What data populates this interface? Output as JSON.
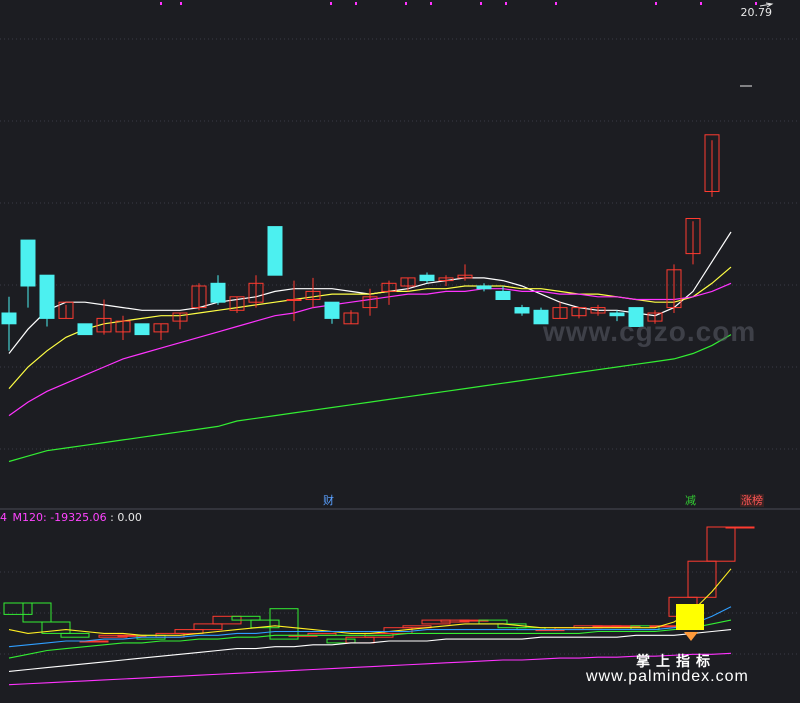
{
  "main_chart": {
    "price_label": "20.79",
    "event_badges": [
      {
        "text": "财",
        "color": "#5aa0ff"
      },
      {
        "text": "减",
        "color": "#33cc33"
      },
      {
        "text": "涨榜",
        "color": "#ff5555"
      }
    ]
  },
  "indicator": {
    "prefix": "4",
    "name": "M120:",
    "value": "-19325.06",
    "separator": ":",
    "value2": "0.00",
    "colors": {
      "name": "#ff44ff",
      "value2": "#e8e8e8"
    }
  },
  "watermark": {
    "site": "www.palmindex.com",
    "cn": "掌上指标",
    "mid": "www.cgzo.com"
  },
  "colors": {
    "background": "#1c1d22",
    "up": "#ff3b30",
    "down": "#4cf0f0",
    "ma_white": "#ffffff",
    "ma_yellow": "#ffff44",
    "ma_magenta": "#ff33ff",
    "ma_green": "#33ee33",
    "grid": "#3a3c46"
  },
  "chart_data": {
    "type": "candlestick",
    "candles": [
      {
        "o": 2.0,
        "h": 2.6,
        "l": 0.6,
        "c": 1.6
      },
      {
        "o": 4.7,
        "h": 4.7,
        "l": 2.2,
        "c": 3.0
      },
      {
        "o": 3.4,
        "h": 3.4,
        "l": 1.5,
        "c": 1.8
      },
      {
        "o": 1.8,
        "h": 2.3,
        "l": 1.8,
        "c": 2.4
      },
      {
        "o": 1.6,
        "h": 1.6,
        "l": 1.2,
        "c": 1.2
      },
      {
        "o": 1.3,
        "h": 2.5,
        "l": 1.2,
        "c": 1.8
      },
      {
        "o": 1.3,
        "h": 1.9,
        "l": 1.0,
        "c": 1.7
      },
      {
        "o": 1.6,
        "h": 1.6,
        "l": 1.3,
        "c": 1.2
      },
      {
        "o": 1.3,
        "h": 1.6,
        "l": 1.0,
        "c": 1.6
      },
      {
        "o": 1.7,
        "h": 2.0,
        "l": 1.4,
        "c": 2.0
      },
      {
        "o": 2.2,
        "h": 3.1,
        "l": 2.1,
        "c": 3.0
      },
      {
        "o": 3.1,
        "h": 3.4,
        "l": 2.3,
        "c": 2.4
      },
      {
        "o": 2.1,
        "h": 2.6,
        "l": 2.0,
        "c": 2.6
      },
      {
        "o": 2.4,
        "h": 3.4,
        "l": 2.2,
        "c": 3.1
      },
      {
        "o": 5.2,
        "h": 5.2,
        "l": 3.4,
        "c": 3.4
      },
      {
        "o": 2.5,
        "h": 3.2,
        "l": 1.7,
        "c": 2.5
      },
      {
        "o": 2.5,
        "h": 3.3,
        "l": 2.2,
        "c": 2.8
      },
      {
        "o": 2.4,
        "h": 2.4,
        "l": 1.6,
        "c": 1.8
      },
      {
        "o": 1.6,
        "h": 2.1,
        "l": 1.6,
        "c": 2.0
      },
      {
        "o": 2.2,
        "h": 2.9,
        "l": 1.9,
        "c": 2.6
      },
      {
        "o": 2.8,
        "h": 3.2,
        "l": 2.3,
        "c": 3.1
      },
      {
        "o": 3.0,
        "h": 3.3,
        "l": 2.8,
        "c": 3.3
      },
      {
        "o": 3.4,
        "h": 3.5,
        "l": 3.1,
        "c": 3.2
      },
      {
        "o": 3.2,
        "h": 3.4,
        "l": 3.0,
        "c": 3.3
      },
      {
        "o": 3.3,
        "h": 3.8,
        "l": 3.2,
        "c": 3.4
      },
      {
        "o": 3.0,
        "h": 3.1,
        "l": 2.8,
        "c": 2.9
      },
      {
        "o": 2.8,
        "h": 3.0,
        "l": 2.5,
        "c": 2.5
      },
      {
        "o": 2.2,
        "h": 2.3,
        "l": 1.9,
        "c": 2.0
      },
      {
        "o": 2.1,
        "h": 2.2,
        "l": 1.6,
        "c": 1.6
      },
      {
        "o": 1.8,
        "h": 2.4,
        "l": 1.8,
        "c": 2.2
      },
      {
        "o": 1.9,
        "h": 2.2,
        "l": 1.8,
        "c": 2.2
      },
      {
        "o": 2.0,
        "h": 2.3,
        "l": 1.9,
        "c": 2.2
      },
      {
        "o": 2.0,
        "h": 2.1,
        "l": 1.7,
        "c": 1.9
      },
      {
        "o": 2.2,
        "h": 2.2,
        "l": 1.5,
        "c": 1.5
      },
      {
        "o": 1.7,
        "h": 2.1,
        "l": 1.6,
        "c": 2.0
      },
      {
        "o": 2.2,
        "h": 3.8,
        "l": 2.0,
        "c": 3.6
      },
      {
        "o": 4.2,
        "h": 5.4,
        "l": 3.8,
        "c": 5.5
      },
      {
        "o": 6.5,
        "h": 8.4,
        "l": 6.3,
        "c": 8.6
      }
    ],
    "ma": [
      {
        "name": "white",
        "color": "#ffffff",
        "values": [
          0.5,
          1.4,
          2.1,
          2.4,
          2.4,
          2.3,
          2.2,
          2.1,
          2.1,
          2.1,
          2.2,
          2.4,
          2.5,
          2.6,
          2.8,
          2.9,
          2.9,
          2.9,
          2.8,
          2.7,
          2.8,
          2.9,
          3.1,
          3.2,
          3.3,
          3.3,
          3.2,
          3.0,
          2.7,
          2.4,
          2.2,
          2.1,
          2.1,
          2.0,
          1.9,
          2.2,
          2.8,
          3.9,
          5.0
        ]
      },
      {
        "name": "yellow",
        "color": "#ffff44",
        "values": [
          -0.8,
          0.0,
          0.6,
          1.1,
          1.4,
          1.6,
          1.7,
          1.8,
          1.9,
          1.9,
          2.0,
          2.1,
          2.2,
          2.3,
          2.4,
          2.5,
          2.6,
          2.7,
          2.7,
          2.7,
          2.8,
          2.8,
          2.9,
          2.9,
          3.0,
          3.0,
          3.0,
          2.9,
          2.9,
          2.8,
          2.7,
          2.7,
          2.6,
          2.5,
          2.4,
          2.4,
          2.6,
          3.1,
          3.7
        ]
      },
      {
        "name": "magenta",
        "color": "#ff33ff",
        "values": [
          -1.8,
          -1.3,
          -0.9,
          -0.6,
          -0.3,
          0.0,
          0.3,
          0.5,
          0.7,
          0.9,
          1.1,
          1.3,
          1.5,
          1.7,
          1.9,
          2.0,
          2.2,
          2.3,
          2.4,
          2.5,
          2.6,
          2.7,
          2.7,
          2.8,
          2.8,
          2.9,
          2.9,
          2.8,
          2.8,
          2.7,
          2.7,
          2.6,
          2.6,
          2.5,
          2.5,
          2.5,
          2.6,
          2.8,
          3.1
        ]
      },
      {
        "name": "green",
        "color": "#33ee33",
        "values": [
          -3.5,
          -3.3,
          -3.1,
          -3.0,
          -2.9,
          -2.8,
          -2.7,
          -2.6,
          -2.5,
          -2.4,
          -2.3,
          -2.2,
          -2.0,
          -1.9,
          -1.8,
          -1.7,
          -1.6,
          -1.5,
          -1.4,
          -1.3,
          -1.2,
          -1.1,
          -1.0,
          -0.9,
          -0.8,
          -0.7,
          -0.6,
          -0.5,
          -0.4,
          -0.3,
          -0.2,
          -0.1,
          0.0,
          0.1,
          0.2,
          0.3,
          0.5,
          0.8,
          1.2
        ]
      }
    ],
    "indicator_bars": [
      {
        "o": 3.0,
        "c": 2.4
      },
      {
        "o": 3.0,
        "c": 2.0
      },
      {
        "o": 2.0,
        "c": 1.4
      },
      {
        "o": 1.4,
        "c": 1.2
      },
      {
        "o": 1.0,
        "c": 1.0
      },
      {
        "o": 1.2,
        "c": 1.3
      },
      {
        "o": 1.3,
        "c": 1.3
      },
      {
        "o": 1.3,
        "c": 1.1
      },
      {
        "o": 1.2,
        "c": 1.4
      },
      {
        "o": 1.4,
        "c": 1.6
      },
      {
        "o": 1.6,
        "c": 1.9
      },
      {
        "o": 1.9,
        "c": 2.3
      },
      {
        "o": 2.3,
        "c": 2.1
      },
      {
        "o": 2.1,
        "c": 1.7
      },
      {
        "o": 2.7,
        "c": 1.1
      },
      {
        "o": 1.3,
        "c": 1.3
      },
      {
        "o": 1.3,
        "c": 1.4
      },
      {
        "o": 1.1,
        "c": 0.9
      },
      {
        "o": 0.9,
        "c": 1.2
      },
      {
        "o": 1.2,
        "c": 1.4
      },
      {
        "o": 1.4,
        "c": 1.7
      },
      {
        "o": 1.7,
        "c": 1.8
      },
      {
        "o": 1.9,
        "c": 2.1
      },
      {
        "o": 2.0,
        "c": 2.1
      },
      {
        "o": 2.1,
        "c": 2.1
      },
      {
        "o": 2.1,
        "c": 1.9
      },
      {
        "o": 1.9,
        "c": 1.7
      },
      {
        "o": 1.7,
        "c": 1.6
      },
      {
        "o": 1.6,
        "c": 1.6
      },
      {
        "o": 1.6,
        "c": 1.7
      },
      {
        "o": 1.7,
        "c": 1.8
      },
      {
        "o": 1.8,
        "c": 1.8
      },
      {
        "o": 1.8,
        "c": 1.8
      },
      {
        "o": 1.8,
        "c": 1.6
      },
      {
        "o": 1.8,
        "c": 1.8
      },
      {
        "o": 2.3,
        "c": 3.3
      },
      {
        "o": 3.3,
        "c": 5.2
      },
      {
        "o": 5.2,
        "c": 7.0
      },
      {
        "o": 7.0,
        "c": 7.0
      }
    ],
    "indicator_lines": [
      {
        "color": "#ffee22",
        "values": [
          1.6,
          1.4,
          1.5,
          1.6,
          1.5,
          1.4,
          1.4,
          1.3,
          1.3,
          1.3,
          1.4,
          1.5,
          1.6,
          1.7,
          1.8,
          1.7,
          1.6,
          1.5,
          1.4,
          1.4,
          1.5,
          1.6,
          1.7,
          1.8,
          1.9,
          1.9,
          1.9,
          1.8,
          1.7,
          1.7,
          1.7,
          1.7,
          1.7,
          1.7,
          1.7,
          2.0,
          2.6,
          3.6,
          4.8
        ]
      },
      {
        "color": "#2f9fff",
        "values": [
          0.7,
          0.8,
          0.9,
          1.0,
          1.0,
          1.1,
          1.1,
          1.2,
          1.2,
          1.2,
          1.3,
          1.3,
          1.4,
          1.4,
          1.5,
          1.5,
          1.5,
          1.5,
          1.5,
          1.5,
          1.5,
          1.5,
          1.6,
          1.6,
          1.6,
          1.6,
          1.6,
          1.6,
          1.6,
          1.6,
          1.6,
          1.6,
          1.6,
          1.6,
          1.6,
          1.7,
          1.9,
          2.3,
          2.8
        ]
      },
      {
        "color": "#33ee33",
        "values": [
          0.1,
          0.3,
          0.5,
          0.6,
          0.7,
          0.8,
          0.9,
          0.9,
          1.0,
          1.0,
          1.1,
          1.1,
          1.2,
          1.2,
          1.3,
          1.3,
          1.3,
          1.3,
          1.3,
          1.3,
          1.3,
          1.4,
          1.4,
          1.4,
          1.4,
          1.4,
          1.4,
          1.4,
          1.4,
          1.4,
          1.4,
          1.5,
          1.5,
          1.5,
          1.5,
          1.6,
          1.7,
          1.9,
          2.1
        ]
      },
      {
        "color": "#ffffff",
        "values": [
          -0.6,
          -0.5,
          -0.4,
          -0.3,
          -0.2,
          -0.1,
          0.0,
          0.1,
          0.2,
          0.3,
          0.4,
          0.5,
          0.6,
          0.6,
          0.7,
          0.7,
          0.8,
          0.8,
          0.9,
          0.9,
          1.0,
          1.0,
          1.0,
          1.1,
          1.1,
          1.1,
          1.1,
          1.1,
          1.2,
          1.2,
          1.2,
          1.2,
          1.2,
          1.3,
          1.3,
          1.3,
          1.4,
          1.5,
          1.6
        ]
      },
      {
        "color": "#ff33ff",
        "values": [
          -1.3,
          -1.25,
          -1.2,
          -1.15,
          -1.1,
          -1.05,
          -1.0,
          -0.95,
          -0.9,
          -0.85,
          -0.8,
          -0.75,
          -0.7,
          -0.65,
          -0.6,
          -0.55,
          -0.5,
          -0.45,
          -0.4,
          -0.35,
          -0.3,
          -0.25,
          -0.2,
          -0.15,
          -0.1,
          -0.05,
          0.0,
          0.0,
          0.05,
          0.1,
          0.1,
          0.15,
          0.15,
          0.2,
          0.2,
          0.25,
          0.3,
          0.3,
          0.35
        ]
      }
    ]
  }
}
